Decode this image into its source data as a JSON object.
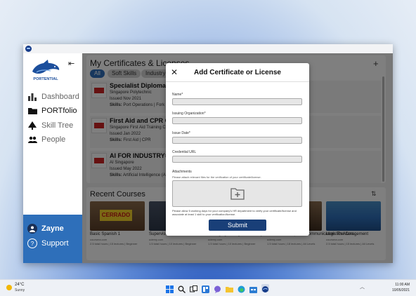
{
  "sidebar": {
    "logo_text": "PORTENTIAL",
    "collapse_icon": "collapse-left-icon",
    "items": [
      {
        "label": "Dashboard",
        "icon": "bar-chart-icon"
      },
      {
        "label": "PORTfolio",
        "icon": "folder-icon"
      },
      {
        "label": "Skill Tree",
        "icon": "tree-icon"
      },
      {
        "label": "People",
        "icon": "people-icon"
      }
    ],
    "user_name": "Zayne",
    "support_label": "Support"
  },
  "certificates": {
    "title": "My Certificates & Licenses",
    "filters": [
      "All",
      "Soft Skills",
      "Industry"
    ],
    "items": [
      {
        "name": "Specialist Diploma in",
        "org": "Singapore Polytechnic",
        "issued": "Issued Nov 2021",
        "skills_label": "Skills:",
        "skills": "Port Operations | Fork"
      },
      {
        "name": "First Aid and CPR Cer",
        "org": "Singapore First Aid Training C",
        "issued": "Issued Jan 2022",
        "skills_label": "Skills:",
        "skills": "First Aid | CPR"
      },
      {
        "name": "AI FOR INDUSTRY®",
        "org": "AI Singapore",
        "issued": "Issued May 2022",
        "skills_label": "Skills:",
        "skills": "Artificial Intelligence (A"
      }
    ]
  },
  "courses": {
    "title": "Recent Courses",
    "items": [
      {
        "title": "Basic Spanish 1",
        "source": "coursera.com",
        "meta": "2.5 total hours | 15 lectures | Beginner"
      },
      {
        "title": "Supervisor Communication",
        "source": "udemy.com",
        "meta": "1.5 total hours | 10 lectures | Beginner"
      },
      {
        "title": "Managing Change Effectively",
        "source": "udemy.com",
        "meta": "1.5 total hours | 10 lectures | Beginner"
      },
      {
        "title": "Effective Workplace Communication: The Com...",
        "source": "udemy.com",
        "meta": "1.5 total hours | 18 lectures | All Levels"
      },
      {
        "title": "Logistics Management",
        "source": "coursera.com",
        "meta": "2.5 total hours | 15 lectures | All Levels"
      }
    ]
  },
  "modal": {
    "title": "Add Certificate or License",
    "fields": [
      {
        "label": "Name*",
        "value": ""
      },
      {
        "label": "Issuing Organization*",
        "value": ""
      },
      {
        "label": "Issue Date*",
        "value": ""
      },
      {
        "label": "Credential URL",
        "value": ""
      }
    ],
    "attachments_label": "Attachments",
    "attachments_hint": "Please attach relevant files for the verification of your certificate/license.",
    "note": "Please allow 5 working days for your company's HR department to verify your certificate/license and associate at least 1 skill to your verification/license.",
    "submit_label": "Submit"
  },
  "taskbar": {
    "temperature": "24°C",
    "weather": "Sunny",
    "time": "11:00 AM",
    "date": "10/05/2021"
  },
  "colors": {
    "accent": "#2e6fba",
    "submit": "#193f78"
  }
}
